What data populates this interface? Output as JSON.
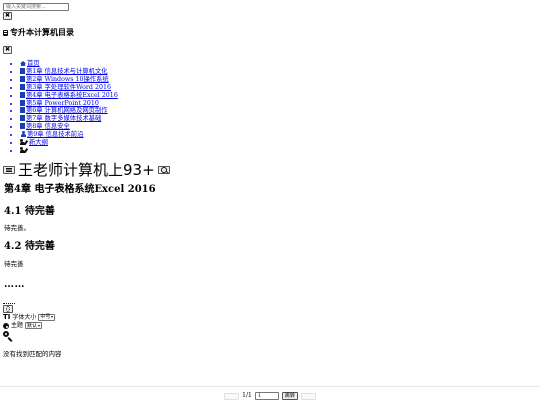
{
  "top_search": {
    "placeholder": "输入关键词搜索..."
  },
  "top_close": {
    "label": "✖"
  },
  "book": {
    "title": "专升本计算机目录"
  },
  "sidebar_close": {
    "label": "✖"
  },
  "toc": [
    {
      "label": "首页",
      "icon": "home-icon"
    },
    {
      "label": "第1章 信息技术与计算机文化",
      "icon": "document-icon"
    },
    {
      "label": "第2章 Windows 10操作系统",
      "icon": "document-icon"
    },
    {
      "label": "第3章 字处理软件Word 2016",
      "icon": "document-icon"
    },
    {
      "label": "第4章 电子表格系统Excel 2016",
      "icon": "document-icon"
    },
    {
      "label": "第5章 PowerPoint 2010",
      "icon": "document-icon"
    },
    {
      "label": "第6章 计算机网络及网页制作",
      "icon": "document-icon"
    },
    {
      "label": "第7章 数字多媒体技术基础",
      "icon": "document-icon"
    },
    {
      "label": "第8章 信息安全",
      "icon": "document-icon"
    },
    {
      "label": "第9章 信息技术前沿",
      "icon": "user-icon"
    },
    {
      "label": "新大纲",
      "icon": "user-icon"
    },
    {
      "label": "",
      "icon": "user-edit-icon"
    }
  ],
  "header": {
    "site_title": "王老师计算机上93+"
  },
  "article": {
    "title": "第4章 电子表格系统Excel 2016",
    "sections": [
      {
        "heading": "4.1 待完善",
        "body": "待完善。"
      },
      {
        "heading": "4.2 待完善",
        "body": "待完善"
      }
    ],
    "ellipsis": "……"
  },
  "settings": {
    "font_size_label": "字体大小",
    "font_size_value": "中号",
    "theme_label": "主题",
    "theme_value": "默认"
  },
  "search_result": {
    "empty_text": "没有找到匹配的内容"
  },
  "pager": {
    "page_indicator": "1/1",
    "page_input_value": "1",
    "go_label": "跳转"
  },
  "colors": {
    "link": "#0000ee",
    "icon_blue": "#1a3fb5"
  }
}
